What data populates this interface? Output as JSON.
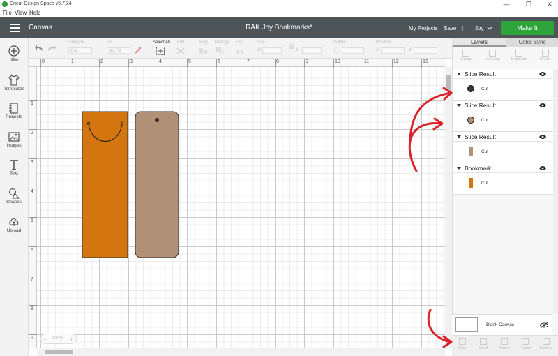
{
  "window": {
    "app_title": "Cricut Design Space  v5.7.24"
  },
  "menu": [
    "File",
    "View",
    "Help"
  ],
  "header": {
    "canvas_label": "Canvas",
    "project_title": "RAK Joy Bookmarks*",
    "my_projects": "My Projects",
    "save": "Save",
    "separator": "|",
    "user": "Joy",
    "make_it": "Make It"
  },
  "toolbar": {
    "linetype_label": "Linetype",
    "linetype_value": "Cut",
    "fill_label": "Fill",
    "fill_value": "No Fill",
    "select_all": "Select All",
    "edit": "Edit",
    "align": "Align",
    "arrange": "Arrange",
    "flip": "Flip",
    "size": "Size",
    "size_w": "W",
    "size_h": "H",
    "rotate": "Rotate",
    "position": "Position",
    "pos_x": "X",
    "pos_y": "Y"
  },
  "sidebar": {
    "items": [
      {
        "label": "New",
        "icon": "plus-circle-icon"
      },
      {
        "label": "Templates",
        "icon": "tshirt-icon"
      },
      {
        "label": "Projects",
        "icon": "notebook-icon"
      },
      {
        "label": "Images",
        "icon": "image-icon"
      },
      {
        "label": "Text",
        "icon": "text-icon"
      },
      {
        "label": "Shapes",
        "icon": "shapes-icon"
      },
      {
        "label": "Upload",
        "icon": "cloud-upload-icon"
      }
    ]
  },
  "ruler": {
    "top": [
      "0",
      "1",
      "2",
      "3",
      "4",
      "5",
      "6",
      "7",
      "8",
      "9",
      "10",
      "11",
      "12",
      "13"
    ],
    "left": [
      "1",
      "2",
      "3",
      "4",
      "5",
      "6",
      "7",
      "8",
      "9"
    ]
  },
  "zoom": {
    "minus": "−",
    "value": "100%",
    "plus": "+"
  },
  "panel": {
    "tabs": [
      "Layers",
      "Color Sync"
    ],
    "layer_tools": [
      "Group",
      "UnGroup",
      "Duplicate",
      "Delete"
    ],
    "groups": [
      {
        "name": "Slice Result",
        "op": "Cut",
        "color": "#3a3a3a",
        "shape": "circle"
      },
      {
        "name": "Slice Result",
        "op": "Cut",
        "color": "#b09077",
        "shape": "circle"
      },
      {
        "name": "Slice Result",
        "op": "Cut",
        "color": "#b09077",
        "shape": "bar"
      },
      {
        "name": "Bookmark",
        "op": "Cut",
        "color": "#d4760f",
        "shape": "bar"
      }
    ],
    "blank_canvas": "Blank Canvas",
    "bottom_tools": [
      "Slice",
      "Weld",
      "Attach",
      "Flatten",
      "Contour"
    ]
  },
  "colors": {
    "orange": "#d4760f",
    "tan": "#b09077",
    "accent_green": "#2ea43a",
    "header_bg": "#4d5558",
    "annotation_red": "#d8232a"
  }
}
